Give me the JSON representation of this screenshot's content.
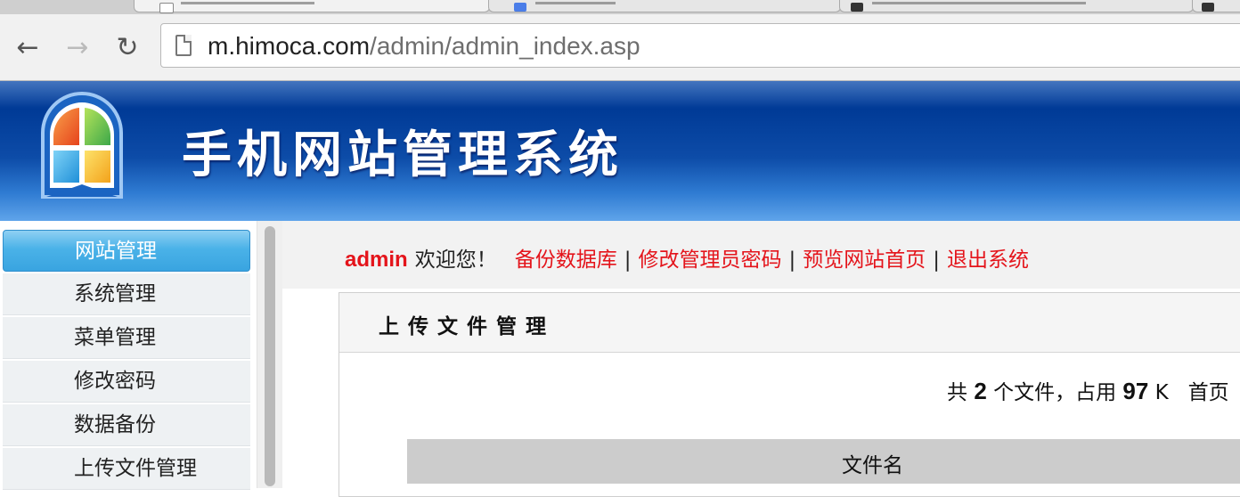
{
  "browser": {
    "url_host": "m.himoca.com",
    "url_path": "/admin/admin_index.asp"
  },
  "banner": {
    "title": "手机网站管理系统"
  },
  "sidebar": {
    "items": [
      {
        "label": "网站管理",
        "active": true
      },
      {
        "label": "系统管理"
      },
      {
        "label": "菜单管理"
      },
      {
        "label": "修改密码"
      },
      {
        "label": "数据备份"
      },
      {
        "label": "上传文件管理"
      }
    ]
  },
  "topbar": {
    "user": "admin",
    "greeting": "欢迎您！",
    "links": [
      "备份数据库",
      "修改管理员密码",
      "预览网站首页",
      "退出系统"
    ],
    "separator": "|"
  },
  "panel": {
    "title": "上传文件管理",
    "stats": {
      "prefix": "共",
      "count": "2",
      "mid": "个文件，占用",
      "size": "97",
      "unit": "K",
      "trailing": "首页"
    },
    "table": {
      "columns": [
        "文件名"
      ]
    }
  },
  "colors": {
    "link_red": "#e4141b",
    "banner_blue": "#003a96",
    "menu_active": "#4ab2e8"
  },
  "icons": {
    "back": "back-arrow-icon",
    "forward": "forward-arrow-icon",
    "reload": "reload-icon",
    "page": "page-icon",
    "logo": "window-logo-icon"
  }
}
